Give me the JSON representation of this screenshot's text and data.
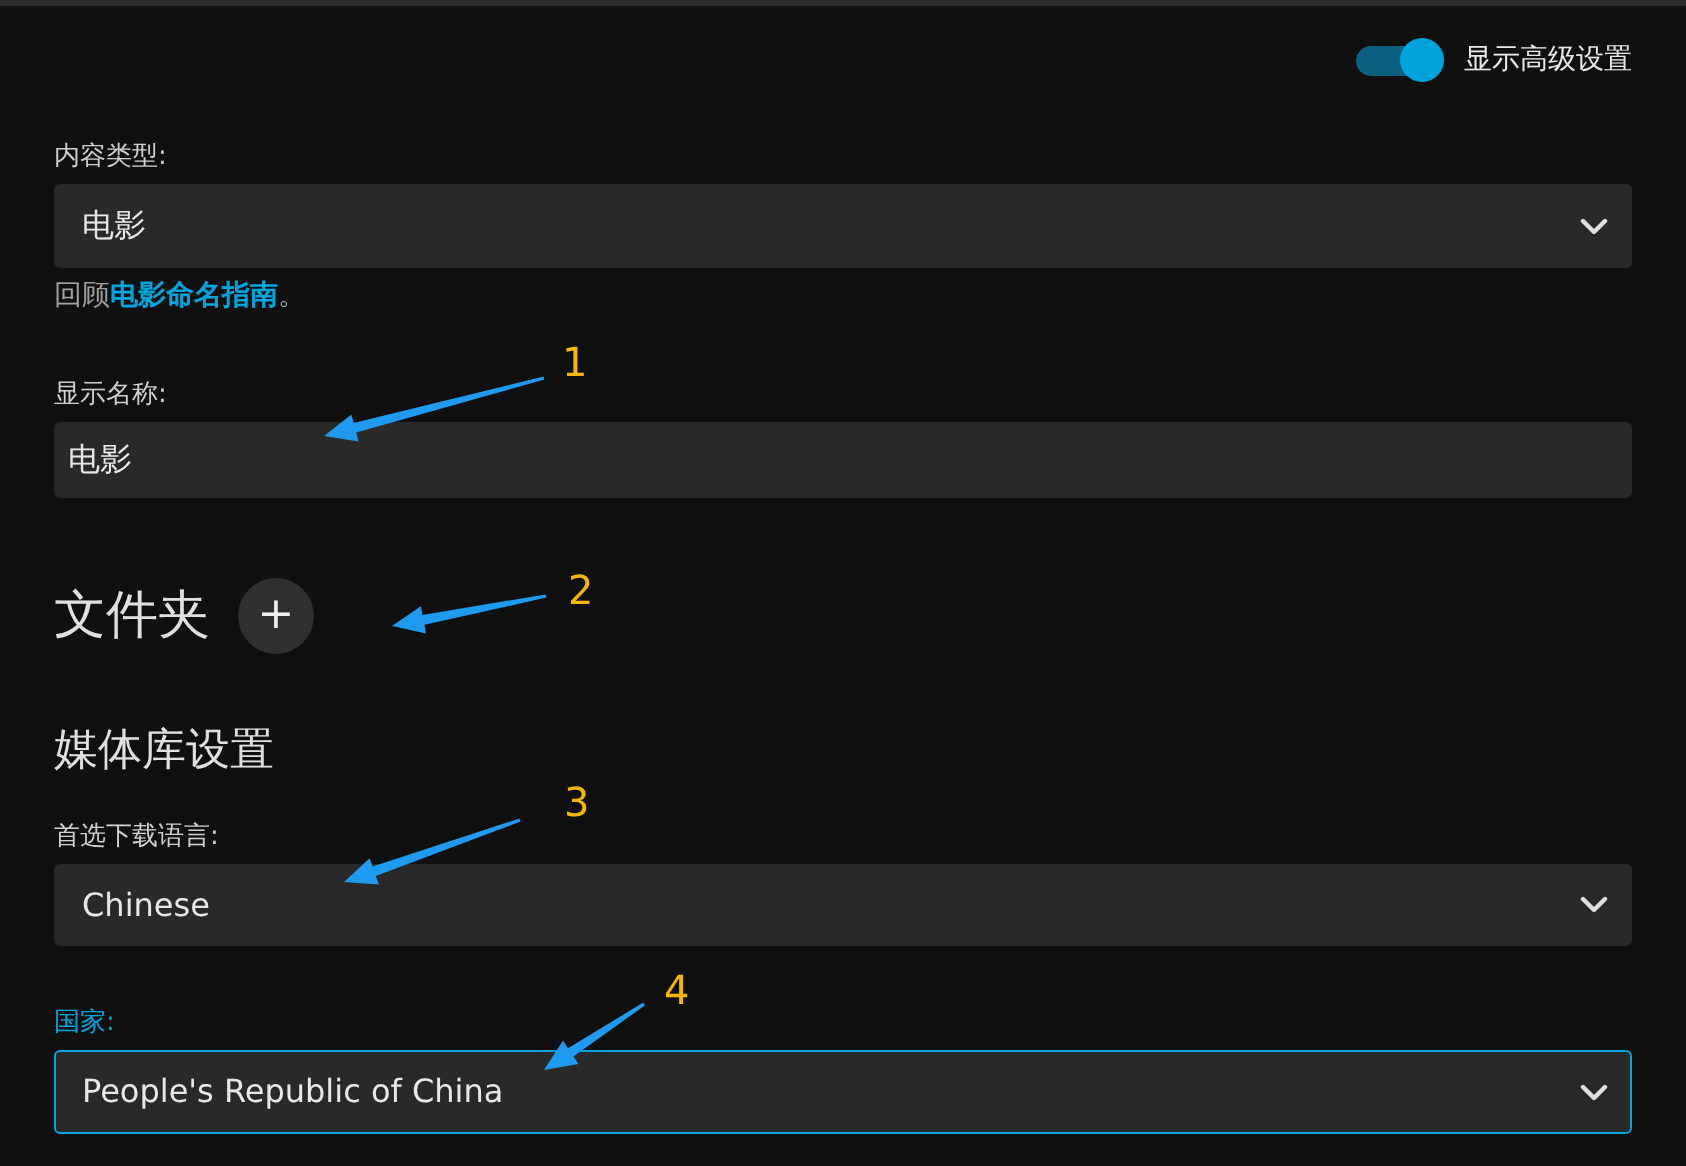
{
  "advanced_toggle": {
    "label": "显示高级设置",
    "on": true
  },
  "content_type": {
    "label": "内容类型:",
    "value": "电影",
    "focused": false
  },
  "hint": {
    "before": "回顾",
    "link": "电影命名指南",
    "after": "。"
  },
  "display_name": {
    "label": "显示名称:",
    "value": "电影"
  },
  "folders": {
    "title": "文件夹",
    "add_button": "+"
  },
  "library_settings": {
    "title": "媒体库设置"
  },
  "language": {
    "label": "首选下载语言:",
    "value": "Chinese",
    "focused": false
  },
  "country": {
    "label": "国家:",
    "value": "People's Republic of China",
    "focused": true
  },
  "annotations": [
    {
      "number": "1"
    },
    {
      "number": "2"
    },
    {
      "number": "3"
    },
    {
      "number": "4"
    }
  ]
}
